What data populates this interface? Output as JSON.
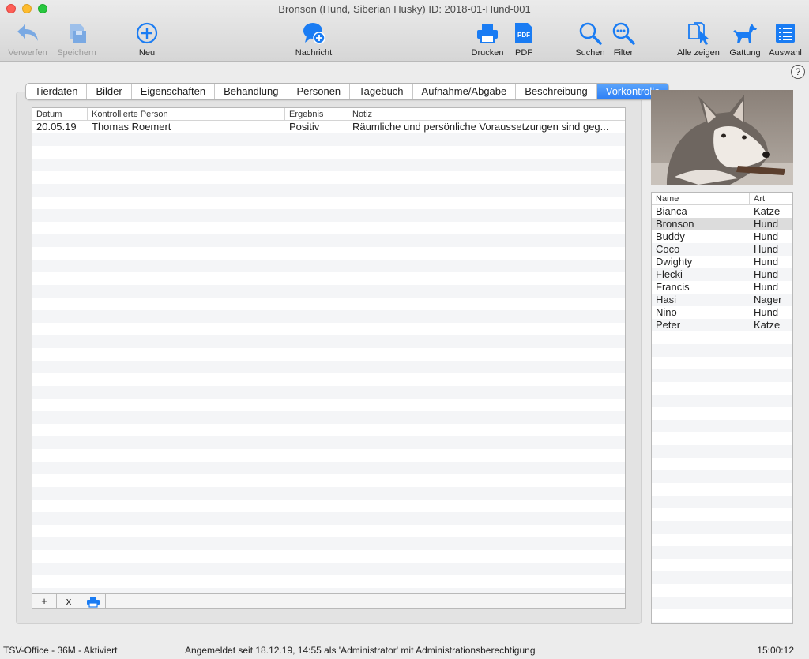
{
  "window": {
    "title": "Bronson (Hund, Siberian Husky) ID: 2018-01-Hund-001"
  },
  "toolbar": {
    "verwerfen": "Verwerfen",
    "speichern": "Speichern",
    "neu": "Neu",
    "nachricht": "Nachricht",
    "drucken": "Drucken",
    "pdf": "PDF",
    "suchen": "Suchen",
    "filter": "Filter",
    "alle_zeigen": "Alle zeigen",
    "gattung": "Gattung",
    "auswahl": "Auswahl",
    "accent_color": "#1a7cf3",
    "disabled_color": "#9b9b9b"
  },
  "help": "?",
  "tabs": [
    {
      "label": "Tierdaten"
    },
    {
      "label": "Bilder"
    },
    {
      "label": "Eigenschaften"
    },
    {
      "label": "Behandlung"
    },
    {
      "label": "Personen"
    },
    {
      "label": "Tagebuch"
    },
    {
      "label": "Aufnahme/Abgabe"
    },
    {
      "label": "Beschreibung"
    },
    {
      "label": "Vorkontrolle"
    }
  ],
  "active_tab": "Vorkontrolle",
  "table": {
    "headers": {
      "datum": "Datum",
      "person": "Kontrollierte Person",
      "ergebnis": "Ergebnis",
      "notiz": "Notiz"
    },
    "rows": [
      {
        "datum": "20.05.19",
        "person": "Thomas Roemert",
        "ergebnis": "Positiv",
        "notiz": "Räumliche und persönliche Voraussetzungen sind geg..."
      }
    ],
    "footer": {
      "add": "+",
      "remove": "x"
    }
  },
  "animal_list": {
    "headers": {
      "name": "Name",
      "art": "Art"
    },
    "items": [
      {
        "name": "Bianca",
        "art": "Katze"
      },
      {
        "name": "Bronson",
        "art": "Hund"
      },
      {
        "name": "Buddy",
        "art": "Hund"
      },
      {
        "name": "Coco",
        "art": "Hund"
      },
      {
        "name": "Dwighty",
        "art": "Hund"
      },
      {
        "name": "Flecki",
        "art": "Hund"
      },
      {
        "name": "Francis",
        "art": "Hund"
      },
      {
        "name": "Hasi",
        "art": "Nager"
      },
      {
        "name": "Nino",
        "art": "Hund"
      },
      {
        "name": "Peter",
        "art": "Katze"
      }
    ],
    "selected": "Bronson"
  },
  "status": {
    "left": "TSV-Office - 36M - Aktiviert",
    "center": "Angemeldet seit 18.12.19, 14:55 als 'Administrator' mit Administrationsberechtigung",
    "right": "15:00:12"
  }
}
